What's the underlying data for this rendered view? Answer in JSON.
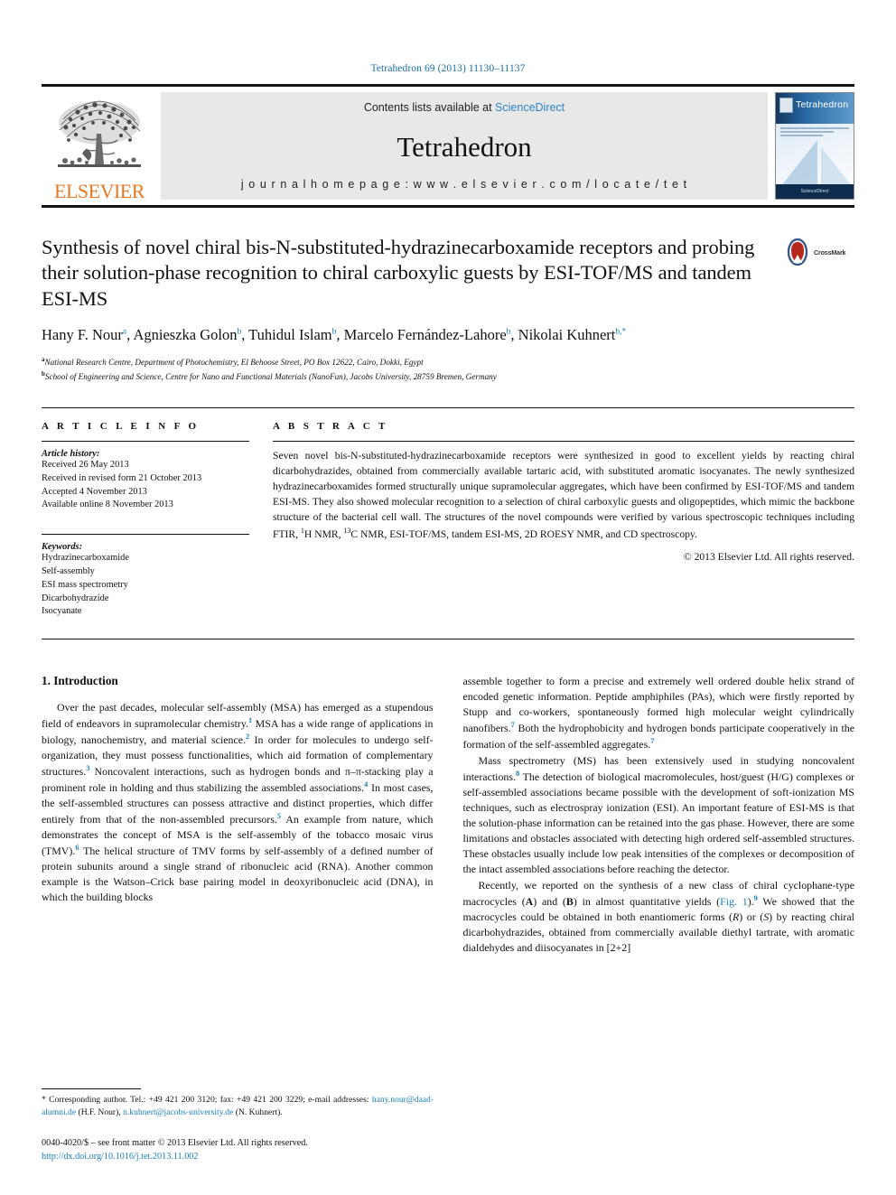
{
  "running_head": "Tetrahedron 69 (2013) 11130–11137",
  "masthead": {
    "publisher": "ELSEVIER",
    "contents_line_prefix": "Contents lists available at ",
    "sciencedirect": "ScienceDirect",
    "journal_title": "Tetrahedron",
    "homepage": "j o u r n a l   h o m e p a g e :   w w w . e l s e v i e r . c o m / l o c a t e / t e t",
    "cover_title": "Tetrahedron",
    "cover_footer": "ScienceDirect"
  },
  "article": {
    "title": "Synthesis of novel chiral bis-N-substituted-hydrazinecarboxamide receptors and probing their solution-phase recognition to chiral carboxylic guests by ESI-TOF/MS and tandem ESI-MS",
    "crossmark_label": "CrossMark",
    "authors_html": "Hany F. Nour<sup>a</sup>, Agnieszka Golon<sup>b</sup>, Tuhidul Islam<sup>b</sup>, Marcelo Fernández-Lahore<sup>b</sup>, Nikolai Kuhnert<sup>b,*</sup>",
    "affiliations": [
      {
        "marker": "a",
        "text": "National Research Centre, Department of Photochemistry, El Behoose Street, PO Box 12622, Cairo, Dokki, Egypt"
      },
      {
        "marker": "b",
        "text": "School of Engineering and Science, Centre for Nano and Functional Materials (NanoFun), Jacobs University, 28759 Bremen, Germany"
      }
    ]
  },
  "info": {
    "heading": "A R T I C L E   I N F O",
    "history_label": "Article history:",
    "history": [
      "Received 26 May 2013",
      "Received in revised form 21 October 2013",
      "Accepted 4 November 2013",
      "Available online 8 November 2013"
    ],
    "keywords_label": "Keywords:",
    "keywords": [
      "Hydrazinecarboxamide",
      "Self-assembly",
      "ESI mass spectrometry",
      "Dicarbohydrazide",
      "Isocyanate"
    ]
  },
  "abstract": {
    "heading": "A B S T R A C T",
    "body_html": "Seven novel bis-N-substituted-hydrazinecarboxamide receptors were synthesized in good to excellent yields by reacting chiral dicarbohydrazides, obtained from commercially available tartaric acid, with substituted aromatic isocyanates. The newly synthesized hydrazinecarboxamides formed structurally unique supramolecular aggregates, which have been confirmed by ESI-TOF/MS and tandem ESI-MS. They also showed molecular recognition to a selection of chiral carboxylic guests and oligopeptides, which mimic the backbone structure of the bacterial cell wall. The structures of the novel compounds were verified by various spectroscopic techniques including FTIR, <sup>1</sup>H NMR, <sup>13</sup>C NMR, ESI-TOF/MS, tandem ESI-MS, 2D ROESY NMR, and CD spectroscopy.",
    "copyright": "© 2013 Elsevier Ltd. All rights reserved."
  },
  "intro": {
    "section_title": "1. Introduction",
    "left_paragraph_html": "Over the past decades, molecular self-assembly (MSA) has emerged as a stupendous field of endeavors in supramolecular chemistry.<sup>1</sup> MSA has a wide range of applications in biology, nanochemistry, and material science.<sup>2</sup> In order for molecules to undergo self-organization, they must possess functionalities, which aid formation of complementary structures.<sup>3</sup> Noncovalent interactions, such as hydrogen bonds and π–π-stacking play a prominent role in holding and thus stabilizing the assembled associations.<sup>4</sup> In most cases, the self-assembled structures can possess attractive and distinct properties, which differ entirely from that of the non-assembled precursors.<sup>5</sup> An example from nature, which demonstrates the concept of MSA is the self-assembly of the tobacco mosaic virus (TMV).<sup>6</sup> The helical structure of TMV forms by self-assembly of a defined number of protein subunits around a single strand of ribonucleic acid (RNA). Another common example is the Watson–Crick base pairing model in deoxyribonucleic acid (DNA), in which the building blocks",
    "right_paragraph1_html": "assemble together to form a precise and extremely well ordered double helix strand of encoded genetic information. Peptide amphiphiles (PAs), which were firstly reported by Stupp and co-workers, spontaneously formed high molecular weight cylindrically nanofibers.<sup>7</sup> Both the hydrophobicity and hydrogen bonds participate cooperatively in the formation of the self-assembled aggregates.<sup>7</sup>",
    "right_paragraph2_html": "Mass spectrometry (MS) has been extensively used in studying noncovalent interactions.<sup>8</sup> The detection of biological macromolecules, host/guest (H/G) complexes or self-assembled associations became possible with the development of soft-ionization MS techniques, such as electrospray ionization (ESI). An important feature of ESI-MS is that the solution-phase information can be retained into the gas phase. However, there are some limitations and obstacles associated with detecting high ordered self-assembled structures. These obstacles usually include low peak intensities of the complexes or decomposition of the intact assembled associations before reaching the detector.",
    "right_paragraph3_html": "Recently, we reported on the synthesis of a new class of chiral cyclophane-type macrocycles (<b>A</b>) and (<b>B</b>) in almost quantitative yields (<span class=\"lnk\">Fig. 1</span>).<sup>9</sup> We showed that the macrocycles could be obtained in both enantiomeric forms (<i>R</i>) or (<i>S</i>) by reacting chiral dicarbohydrazides, obtained from commercially available diethyl tartrate, with aromatic dialdehydes and diisocyanates in [2+2]"
  },
  "footnote": {
    "corresponding_html": "* Corresponding author. Tel.: +49 421 200 3120; fax: +49 421 200 3229; e-mail addresses: <span class=\"mail\">hany.nour@daad-alumni.de</span> (H.F. Nour), <span class=\"mail\">n.kuhnert@jacobs-university.de</span> (N. Kuhnert).",
    "issn_line": "0040-4020/$ – see front matter © 2013 Elsevier Ltd. All rights reserved.",
    "doi": "http://dx.doi.org/10.1016/j.tet.2013.11.002"
  },
  "colors": {
    "link_blue": "#1a7db6",
    "elsevier_orange": "#E87722",
    "header_blue": "#1a6fa8"
  }
}
